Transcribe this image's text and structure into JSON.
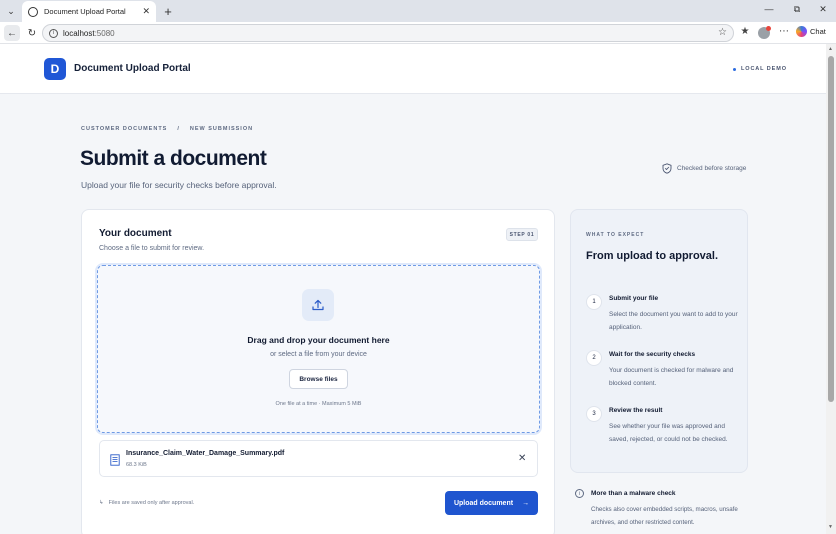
{
  "browser": {
    "tab_title": "Document Upload Portal",
    "url_host": "localhost",
    "url_port": ":5080",
    "chat_label": "Chat"
  },
  "header": {
    "brand_initial": "D",
    "brand_name": "Document Upload Portal",
    "env_label": "LOCAL DEMO"
  },
  "breadcrumb": {
    "items": [
      "CUSTOMER DOCUMENTS",
      "NEW SUBMISSION"
    ],
    "separator": "/"
  },
  "page": {
    "title": "Submit a document",
    "subtitle": "Upload your file for security checks before approval.",
    "checked_label": "Checked before storage"
  },
  "upload": {
    "title": "Your document",
    "subtitle": "Choose a file to submit for review.",
    "step": "STEP 01",
    "dropzone_title": "Drag and drop your document here",
    "dropzone_sub": "or select a file from your device",
    "browse_label": "Browse files",
    "limit": "One file at a time · Maximum 5 MiB",
    "file_name": "Insurance_Claim_Water_Damage_Summary.pdf",
    "file_size": "68.3 KiB",
    "saved_note": "Files are saved only after approval.",
    "submit_label": "Upload document"
  },
  "side": {
    "eyebrow": "WHAT TO EXPECT",
    "title": "From upload to approval.",
    "steps": [
      {
        "num": "1",
        "title": "Submit your file",
        "desc": "Select the document you want to add to your application."
      },
      {
        "num": "2",
        "title": "Wait for the security checks",
        "desc": "Your document is checked for malware and blocked content."
      },
      {
        "num": "3",
        "title": "Review the result",
        "desc": "See whether your file was approved and saved, rejected, or could not be checked."
      }
    ],
    "more_title": "More than a malware check",
    "more_desc": "Checks also cover embedded scripts, macros, unsafe archives, and other restricted content."
  },
  "colors": {
    "accent": "#1f55cf",
    "page_bg": "#f4f6f9",
    "side_bg": "#eef2f8",
    "dropzone_border": "#6f9be5"
  },
  "icons": [
    "chevron-down-icon",
    "globe-icon",
    "close-icon",
    "plus-icon",
    "minimize-icon",
    "restore-icon",
    "back-icon",
    "reload-icon",
    "info-icon",
    "star-icon",
    "favorites-icon",
    "more-icon",
    "shield-icon",
    "upload-icon",
    "document-icon",
    "arrow-right-icon"
  ]
}
